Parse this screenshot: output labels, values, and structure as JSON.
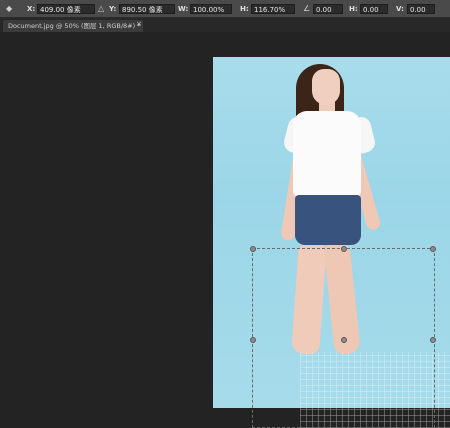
{
  "options_bar": {
    "x_label": "X:",
    "x_value": "409.00 像素",
    "y_label": "Y:",
    "y_value": "890.50 像素",
    "w_label": "W:",
    "w_value": "100.00%",
    "h_label": "H:",
    "h_value": "116.70%",
    "angle_value": "0.00",
    "hskew_label": "H:",
    "hskew_value": "0.00",
    "vskew_label": "V:",
    "vskew_value": "0.00"
  },
  "document": {
    "tab_title": "Document.jpg @ 50% (图层 1, RGB/8#) *",
    "tab_close": "×"
  },
  "icons": {
    "reference_point": "reference-point-icon",
    "link": "link-icon",
    "angle": "angle-icon"
  },
  "colors": {
    "workspace": "#232323",
    "options_bar": "#4a4a4a",
    "photo_background": "#a8dceb"
  }
}
